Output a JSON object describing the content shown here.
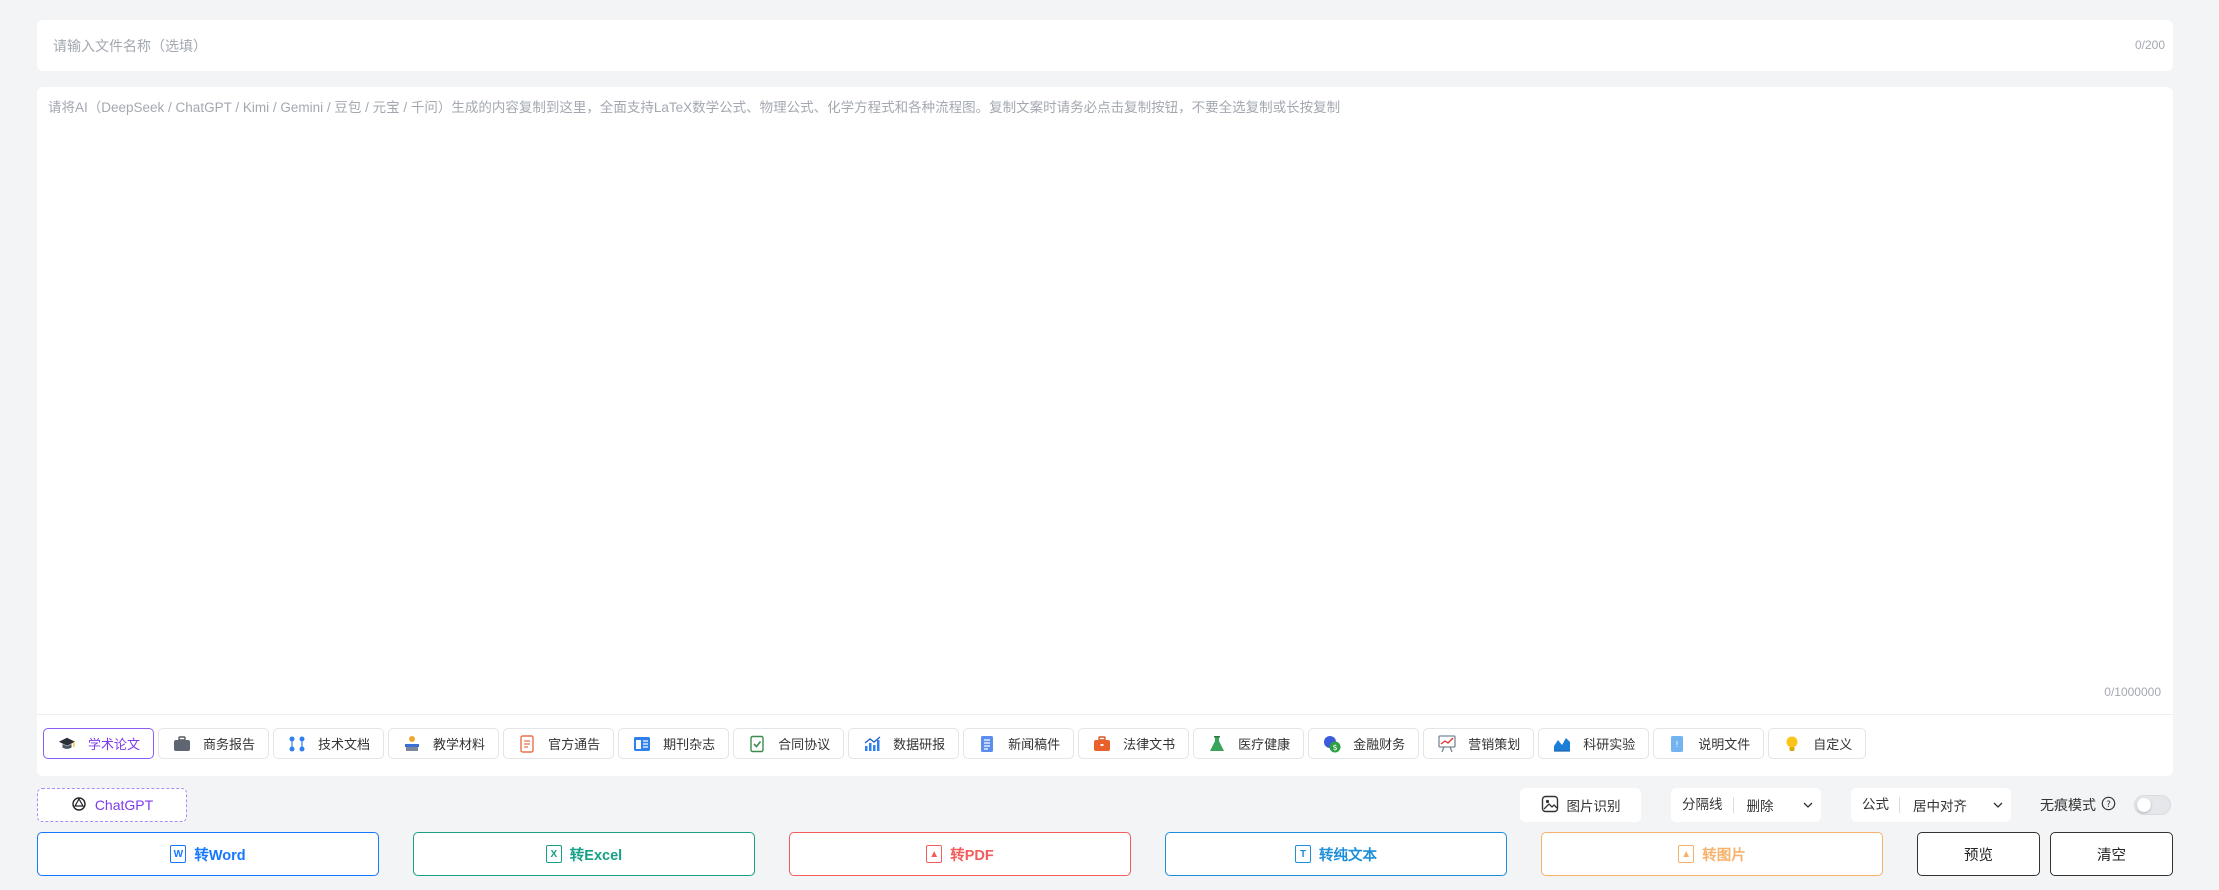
{
  "filename": {
    "placeholder": "请输入文件名称（选填）",
    "count": "0/200"
  },
  "content": {
    "placeholder": "请将AI（DeepSeek / ChatGPT / Kimi / Gemini / 豆包 / 元宝 / 千问）生成的内容复制到这里，全面支持LaTeX数学公式、物理公式、化学方程式和各种流程图。复制文案时请务必点击复制按钮，不要全选复制或长按复制",
    "count": "0/1000000"
  },
  "templates": [
    {
      "label": "学术论文",
      "icon": "graduation-cap-icon",
      "active": true
    },
    {
      "label": "商务报告",
      "icon": "briefcase-icon"
    },
    {
      "label": "技术文档",
      "icon": "nodes-icon"
    },
    {
      "label": "教学材料",
      "icon": "teaching-icon"
    },
    {
      "label": "官方通告",
      "icon": "notice-doc-icon"
    },
    {
      "label": "期刊杂志",
      "icon": "magazine-icon"
    },
    {
      "label": "合同协议",
      "icon": "contract-check-icon"
    },
    {
      "label": "数据研报",
      "icon": "bar-chart-icon"
    },
    {
      "label": "新闻稿件",
      "icon": "news-icon"
    },
    {
      "label": "法律文书",
      "icon": "legal-case-icon"
    },
    {
      "label": "医疗健康",
      "icon": "flask-icon"
    },
    {
      "label": "金融财务",
      "icon": "finance-icon"
    },
    {
      "label": "营销策划",
      "icon": "marketing-board-icon"
    },
    {
      "label": "科研实验",
      "icon": "research-chart-icon"
    },
    {
      "label": "说明文件",
      "icon": "manual-icon"
    },
    {
      "label": "自定义",
      "icon": "lightbulb-icon"
    }
  ],
  "controls": {
    "model_label": "ChatGPT",
    "ocr_label": "图片识别",
    "divider_label": "分隔线",
    "divider_value": "删除",
    "formula_label": "公式",
    "formula_value": "居中对齐",
    "no_trace_label": "无痕模式",
    "no_trace_on": false
  },
  "convert_buttons": [
    {
      "label": "转Word",
      "icon_text": "W",
      "color": "#1677ff"
    },
    {
      "label": "转Excel",
      "icon_text": "X",
      "color": "#16a085"
    },
    {
      "label": "转PDF",
      "icon_text": "▲",
      "color": "#f25c5c"
    },
    {
      "label": "转纯文本",
      "icon_text": "T",
      "color": "#1d8fd8"
    },
    {
      "label": "转图片",
      "icon_text": "▲",
      "color": "#f6b26b"
    }
  ],
  "actions": {
    "preview_label": "预览",
    "clear_label": "清空"
  }
}
